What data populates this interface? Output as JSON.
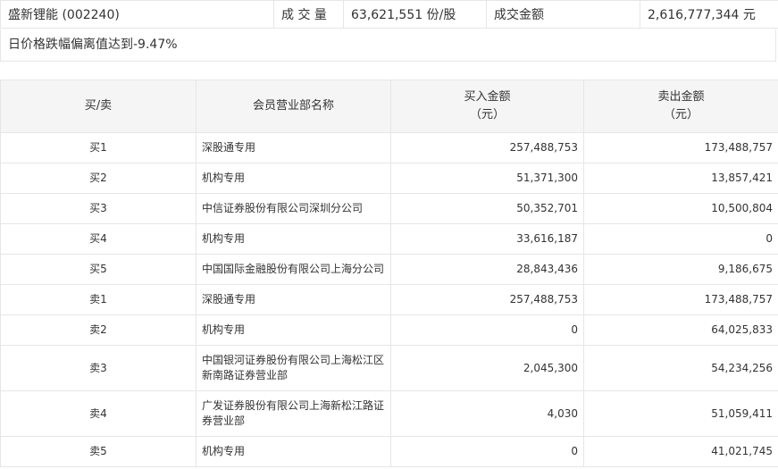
{
  "stock": {
    "name_code": "盛新锂能 (002240)",
    "volume_label": "成 交 量",
    "volume_value": "63,621,551 份/股",
    "amount_label": "成交金额",
    "amount_value": "2,616,777,344 元"
  },
  "note": "日价格跌幅偏离值达到-9.47%",
  "table": {
    "headers": {
      "side": "买/卖",
      "name": "会员营业部名称",
      "buy_line1": "买入金额",
      "buy_line2": "（元）",
      "sell_line1": "卖出金额",
      "sell_line2": "（元）"
    },
    "rows": [
      {
        "side": "买1",
        "name": "深股通专用",
        "buy": "257,488,753",
        "sell": "173,488,757"
      },
      {
        "side": "买2",
        "name": "机构专用",
        "buy": "51,371,300",
        "sell": "13,857,421"
      },
      {
        "side": "买3",
        "name": "中信证券股份有限公司深圳分公司",
        "buy": "50,352,701",
        "sell": "10,500,804"
      },
      {
        "side": "买4",
        "name": "机构专用",
        "buy": "33,616,187",
        "sell": "0"
      },
      {
        "side": "买5",
        "name": "中国国际金融股份有限公司上海分公司",
        "buy": "28,843,436",
        "sell": "9,186,675"
      },
      {
        "side": "卖1",
        "name": "深股通专用",
        "buy": "257,488,753",
        "sell": "173,488,757"
      },
      {
        "side": "卖2",
        "name": "机构专用",
        "buy": "0",
        "sell": "64,025,833"
      },
      {
        "side": "卖3",
        "name": "中国银河证券股份有限公司上海松江区新南路证券营业部",
        "buy": "2,045,300",
        "sell": "54,234,256"
      },
      {
        "side": "卖4",
        "name": "广发证券股份有限公司上海新松江路证券营业部",
        "buy": "4,030",
        "sell": "51,059,411"
      },
      {
        "side": "卖5",
        "name": "机构专用",
        "buy": "0",
        "sell": "41,021,745"
      }
    ]
  }
}
